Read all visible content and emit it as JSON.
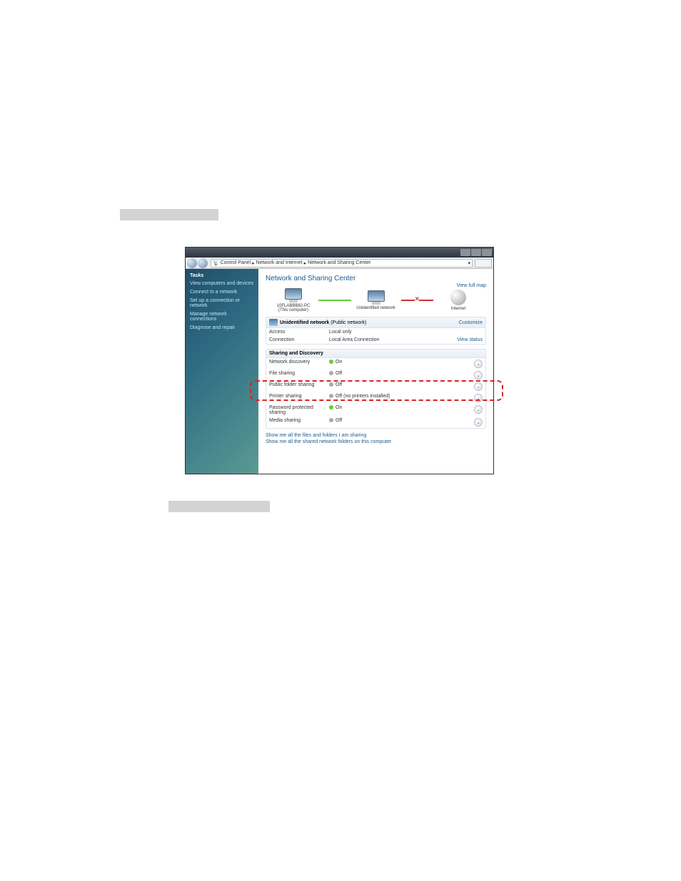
{
  "breadcrumb": [
    "Control Panel",
    "Network and Internet",
    "Network and Sharing Center"
  ],
  "sidebar": {
    "header": "Tasks",
    "items": [
      "View computers and devices",
      "Connect to a network",
      "Set up a connection or network",
      "Manage network connections",
      "Diagnose and repair"
    ]
  },
  "main": {
    "title": "Network and Sharing Center",
    "fullmap": "View full map",
    "nodes": {
      "pc": {
        "name": "10FLABBB82-PC",
        "sub": "(This computer)"
      },
      "net": {
        "name": "Unidentified network"
      },
      "internet": {
        "name": "Internet"
      }
    },
    "group1": {
      "title_strong": "Unidentified network",
      "title_paren": "(Public network)",
      "customize": "Customize",
      "rows": {
        "access_k": "Access",
        "access_v": "Local only",
        "conn_k": "Connection",
        "conn_v": "Local Area Connection",
        "viewstatus": "View status"
      }
    },
    "group2": {
      "title": "Sharing and Discovery",
      "items": [
        {
          "k": "Network discovery",
          "state": "on",
          "v": "On"
        },
        {
          "k": "File sharing",
          "state": "off",
          "v": "Off"
        },
        {
          "k": "Public folder sharing",
          "state": "off",
          "v": "Off"
        },
        {
          "k": "Printer sharing",
          "state": "off",
          "v": "Off (no printers installed)"
        },
        {
          "k": "Password protected sharing",
          "state": "on",
          "v": "On"
        },
        {
          "k": "Media sharing",
          "state": "off",
          "v": "Off"
        }
      ]
    },
    "links": [
      "Show me all the files and folders I am sharing",
      "Show me all the shared network folders on this computer"
    ]
  }
}
